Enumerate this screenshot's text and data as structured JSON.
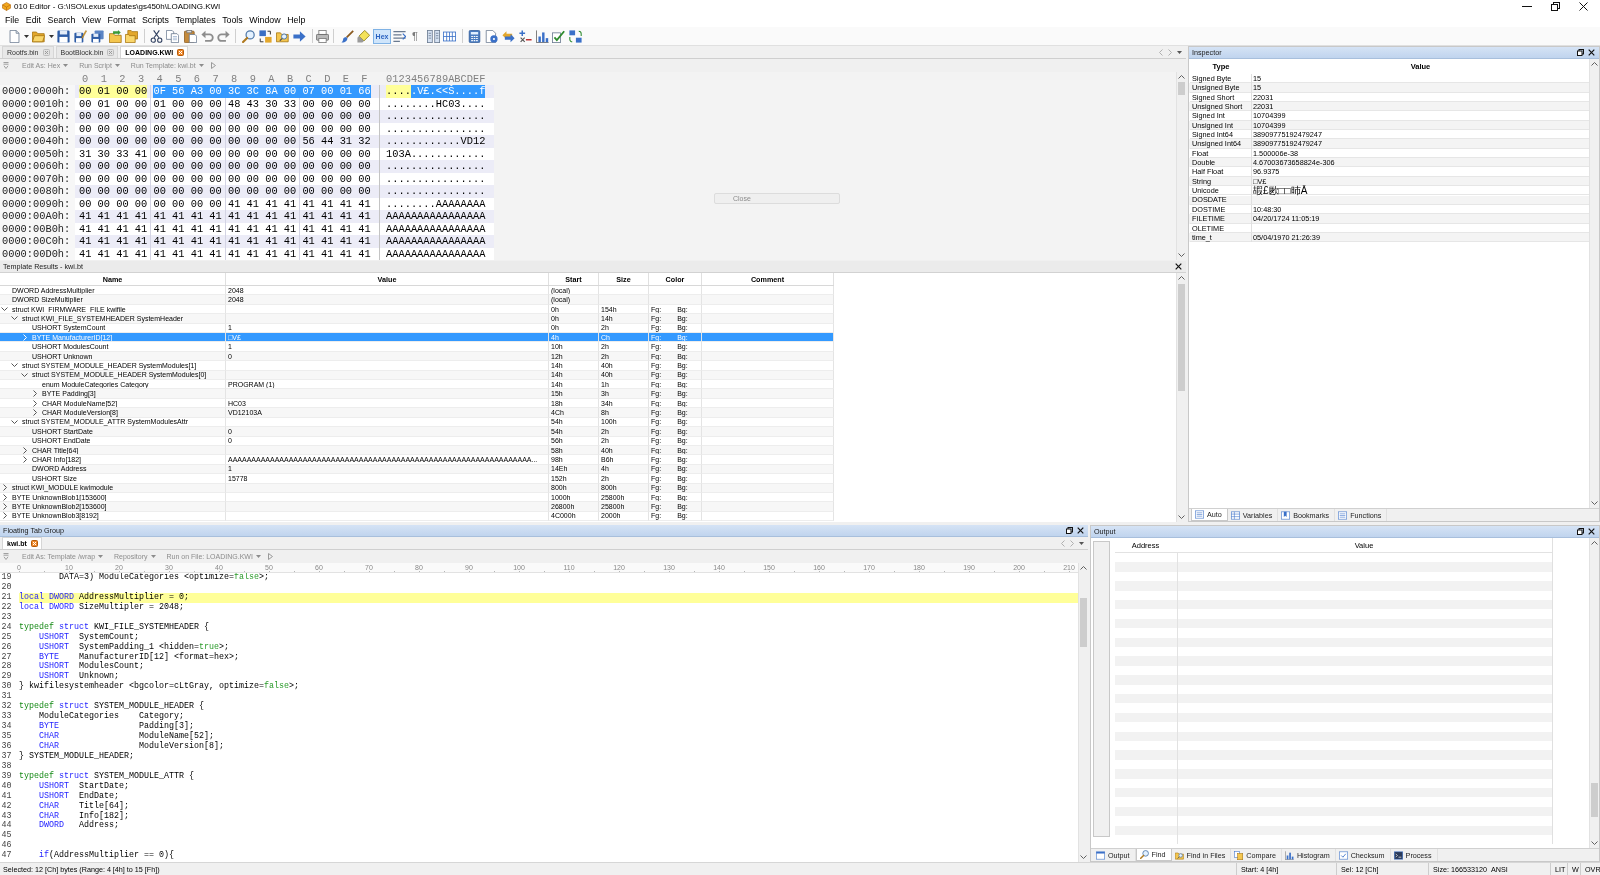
{
  "window": {
    "title": "010 Editor - G:\\ISO\\Lexus updates\\gs450h\\LOADING.KWI"
  },
  "menu": [
    "File",
    "Edit",
    "Search",
    "View",
    "Format",
    "Scripts",
    "Templates",
    "Tools",
    "Window",
    "Help"
  ],
  "toolbar": {
    "hex_button": {
      "label": "Hex",
      "on": true
    },
    "pilcrow": "¶"
  },
  "file_tabs": [
    {
      "label": "Rootfs.bin",
      "selected": false
    },
    {
      "label": "BootBlock.bin",
      "selected": false
    },
    {
      "label": "LOADING.KWI",
      "selected": true
    }
  ],
  "hex_view": {
    "toolbar": [
      "Edit As: Hex",
      "Run Script",
      "Run Template: kwi.bt"
    ],
    "columns": [
      "0",
      "1",
      "2",
      "3",
      "4",
      "5",
      "6",
      "7",
      "8",
      "9",
      "A",
      "B",
      "C",
      "D",
      "E",
      "F"
    ],
    "ascii_header": "0123456789ABCDEF",
    "rows": [
      {
        "address": "0000:0000h:",
        "spans": [
          {
            "marked": true,
            "selected": false,
            "bytes": [
              "00",
              "01",
              "00",
              "00"
            ],
            "ascii": "...."
          },
          {
            "marked": false,
            "selected": true,
            "bytes": [
              "0F",
              "56",
              "A3",
              "00",
              "3C",
              "3C",
              "8A",
              "00",
              "07",
              "00",
              "01",
              "66"
            ],
            "ascii": ".V£.<<Š....f"
          }
        ]
      },
      {
        "address": "0000:0010h:",
        "spans": [
          {
            "marked": false,
            "selected": false,
            "bytes": [
              "00",
              "01",
              "00",
              "00",
              "01",
              "00",
              "00",
              "00",
              "48",
              "43",
              "30",
              "33",
              "00",
              "00",
              "00",
              "00"
            ],
            "ascii": "........HC03...."
          }
        ]
      },
      {
        "address": "0000:0020h:",
        "spans": [
          {
            "marked": false,
            "selected": false,
            "bytes": [
              "00",
              "00",
              "00",
              "00",
              "00",
              "00",
              "00",
              "00",
              "00",
              "00",
              "00",
              "00",
              "00",
              "00",
              "00",
              "00"
            ],
            "ascii": "................"
          }
        ]
      },
      {
        "address": "0000:0030h:",
        "spans": [
          {
            "marked": false,
            "selected": false,
            "bytes": [
              "00",
              "00",
              "00",
              "00",
              "00",
              "00",
              "00",
              "00",
              "00",
              "00",
              "00",
              "00",
              "00",
              "00",
              "00",
              "00"
            ],
            "ascii": "................"
          }
        ]
      },
      {
        "address": "0000:0040h:",
        "spans": [
          {
            "marked": false,
            "selected": false,
            "bytes": [
              "00",
              "00",
              "00",
              "00",
              "00",
              "00",
              "00",
              "00",
              "00",
              "00",
              "00",
              "00",
              "56",
              "44",
              "31",
              "32"
            ],
            "ascii": "............VD12"
          }
        ]
      },
      {
        "address": "0000:0050h:",
        "spans": [
          {
            "marked": false,
            "selected": false,
            "bytes": [
              "31",
              "30",
              "33",
              "41",
              "00",
              "00",
              "00",
              "00",
              "00",
              "00",
              "00",
              "00",
              "00",
              "00",
              "00",
              "00"
            ],
            "ascii": "103A............"
          }
        ]
      },
      {
        "address": "0000:0060h:",
        "spans": [
          {
            "marked": false,
            "selected": false,
            "bytes": [
              "00",
              "00",
              "00",
              "00",
              "00",
              "00",
              "00",
              "00",
              "00",
              "00",
              "00",
              "00",
              "00",
              "00",
              "00",
              "00"
            ],
            "ascii": "................"
          }
        ]
      },
      {
        "address": "0000:0070h:",
        "spans": [
          {
            "marked": false,
            "selected": false,
            "bytes": [
              "00",
              "00",
              "00",
              "00",
              "00",
              "00",
              "00",
              "00",
              "00",
              "00",
              "00",
              "00",
              "00",
              "00",
              "00",
              "00"
            ],
            "ascii": "................"
          }
        ]
      },
      {
        "address": "0000:0080h:",
        "spans": [
          {
            "marked": false,
            "selected": false,
            "bytes": [
              "00",
              "00",
              "00",
              "00",
              "00",
              "00",
              "00",
              "00",
              "00",
              "00",
              "00",
              "00",
              "00",
              "00",
              "00",
              "00"
            ],
            "ascii": "................"
          }
        ]
      },
      {
        "address": "0000:0090h:",
        "spans": [
          {
            "marked": false,
            "selected": false,
            "bytes": [
              "00",
              "00",
              "00",
              "00",
              "00",
              "00",
              "00",
              "00",
              "41",
              "41",
              "41",
              "41",
              "41",
              "41",
              "41",
              "41"
            ],
            "ascii": "........AAAAAAAA"
          }
        ]
      },
      {
        "address": "0000:00A0h:",
        "spans": [
          {
            "marked": false,
            "selected": false,
            "bytes": [
              "41",
              "41",
              "41",
              "41",
              "41",
              "41",
              "41",
              "41",
              "41",
              "41",
              "41",
              "41",
              "41",
              "41",
              "41",
              "41"
            ],
            "ascii": "AAAAAAAAAAAAAAAA"
          }
        ]
      },
      {
        "address": "0000:00B0h:",
        "spans": [
          {
            "marked": false,
            "selected": false,
            "bytes": [
              "41",
              "41",
              "41",
              "41",
              "41",
              "41",
              "41",
              "41",
              "41",
              "41",
              "41",
              "41",
              "41",
              "41",
              "41",
              "41"
            ],
            "ascii": "AAAAAAAAAAAAAAAA"
          }
        ]
      },
      {
        "address": "0000:00C0h:",
        "spans": [
          {
            "marked": false,
            "selected": false,
            "bytes": [
              "41",
              "41",
              "41",
              "41",
              "41",
              "41",
              "41",
              "41",
              "41",
              "41",
              "41",
              "41",
              "41",
              "41",
              "41",
              "41"
            ],
            "ascii": "AAAAAAAAAAAAAAAA"
          }
        ]
      },
      {
        "address": "0000:00D0h:",
        "spans": [
          {
            "marked": false,
            "selected": false,
            "bytes": [
              "41",
              "41",
              "41",
              "41",
              "41",
              "41",
              "41",
              "41",
              "41",
              "41",
              "41",
              "41",
              "41",
              "41",
              "41",
              "41"
            ],
            "ascii": "AAAAAAAAAAAAAAAA"
          }
        ]
      }
    ],
    "overlay_button": "Close"
  },
  "template_results": {
    "title": "Template Results - kwi.bt",
    "columns": [
      "Name",
      "Value",
      "Start",
      "Size",
      "Color",
      "Comment"
    ],
    "rows": [
      {
        "name": "DWORD AddressMultiplier",
        "value": "2048",
        "start": "(local)",
        "selected": false
      },
      {
        "name": "DWORD SizeMultiplier",
        "value": "2048",
        "start": "(local)",
        "selected": false
      },
      {
        "name": "struct KWI_FIRMWARE_FILE kwifile",
        "start": "0h",
        "size": "154h",
        "fg": "Fg:",
        "bg": "Bg:",
        "expanded": true,
        "selected": false,
        "children": [
          {
            "name": "struct KWI_FILE_SYSTEMHEADER SystemHeader",
            "start": "0h",
            "size": "14h",
            "fg": "Fg:",
            "bg": "Bg:",
            "expanded": true,
            "selected": false,
            "children": [
              {
                "name": "USHORT SystemCount",
                "value": "1",
                "start": "0h",
                "size": "2h",
                "fg": "Fg:",
                "bg": "Bg:",
                "selected": false
              },
              {
                "name": "BYTE ManufacturerID[12]",
                "value": "□V£",
                "start": "4h",
                "size": "Ch",
                "fg": "Fg:",
                "bg": "Bg:",
                "expanded": false,
                "selected": true
              },
              {
                "name": "USHORT ModulesCount",
                "value": "1",
                "start": "10h",
                "size": "2h",
                "fg": "Fg:",
                "bg": "Bg:",
                "selected": false
              },
              {
                "name": "USHORT Unknown",
                "value": "0",
                "start": "12h",
                "size": "2h",
                "fg": "Fg:",
                "bg": "Bg:",
                "selected": false
              }
            ]
          },
          {
            "name": "struct SYSTEM_MODULE_HEADER SystemModules[1]",
            "start": "14h",
            "size": "40h",
            "fg": "Fg:",
            "bg": "Bg:",
            "expanded": true,
            "selected": false,
            "children": [
              {
                "name": "struct SYSTEM_MODULE_HEADER SystemModules[0]",
                "start": "14h",
                "size": "40h",
                "fg": "Fg:",
                "bg": "Bg:",
                "expanded": true,
                "selected": false,
                "children": [
                  {
                    "name": "enum ModuleCategories Category",
                    "value": "PROGRAM (1)",
                    "start": "14h",
                    "size": "1h",
                    "fg": "Fg:",
                    "bg": "Bg:",
                    "selected": false
                  },
                  {
                    "name": "BYTE Padding[3]",
                    "start": "15h",
                    "size": "3h",
                    "fg": "Fg:",
                    "bg": "Bg:",
                    "expanded": false,
                    "selected": false
                  },
                  {
                    "name": "CHAR ModuleName[52]",
                    "value": "HC03",
                    "start": "18h",
                    "size": "34h",
                    "fg": "Fg:",
                    "bg": "Bg:",
                    "expanded": false,
                    "selected": false
                  },
                  {
                    "name": "CHAR ModuleVersion[8]",
                    "value": "VD12103A",
                    "start": "4Ch",
                    "size": "8h",
                    "fg": "Fg:",
                    "bg": "Bg:",
                    "expanded": false,
                    "selected": false
                  }
                ]
              }
            ]
          },
          {
            "name": "struct SYSTEM_MODULE_ATTR SystemModulesAttr",
            "start": "54h",
            "size": "100h",
            "fg": "Fg:",
            "bg": "Bg:",
            "expanded": true,
            "selected": false,
            "children": [
              {
                "name": "USHORT StartDate",
                "value": "0",
                "start": "54h",
                "size": "2h",
                "fg": "Fg:",
                "bg": "Bg:",
                "selected": false
              },
              {
                "name": "USHORT EndDate",
                "value": "0",
                "start": "56h",
                "size": "2h",
                "fg": "Fg:",
                "bg": "Bg:",
                "selected": false
              },
              {
                "name": "CHAR Title[64]",
                "start": "58h",
                "size": "40h",
                "fg": "Fg:",
                "bg": "Bg:",
                "expanded": false,
                "selected": false
              },
              {
                "name": "CHAR Info[182]",
                "value": "AAAAAAAAAAAAAAAAAAAAAAAAAAAAAAAAAAAAAAAAAAAAAAAAAAAAAAAAAAAAAAAAA...",
                "start": "98h",
                "size": "B6h",
                "fg": "Fg:",
                "bg": "Bg:",
                "expanded": false,
                "selected": false
              },
              {
                "name": "DWORD Address",
                "value": "1",
                "start": "14Eh",
                "size": "4h",
                "fg": "Fg:",
                "bg": "Bg:",
                "selected": false
              },
              {
                "name": "USHORT Size",
                "value": "15778",
                "start": "152h",
                "size": "2h",
                "fg": "Fg:",
                "bg": "Bg:",
                "selected": false
              }
            ]
          }
        ]
      },
      {
        "name": "struct KWI_MODULE kwimodule",
        "start": "800h",
        "size": "800h",
        "fg": "Fg:",
        "bg": "Bg:",
        "expanded": false,
        "selected": false
      },
      {
        "name": "BYTE UnknownBlob1[153600]",
        "start": "1000h",
        "size": "25800h",
        "fg": "Fg:",
        "bg": "Bg:",
        "expanded": false,
        "selected": false
      },
      {
        "name": "BYTE UnknownBlob2[153600]",
        "start": "26800h",
        "size": "25800h",
        "fg": "Fg:",
        "bg": "Bg:",
        "expanded": false,
        "selected": false
      },
      {
        "name": "BYTE UnknownBlob3[8192]",
        "start": "4C000h",
        "size": "2000h",
        "fg": "Fg:",
        "bg": "Bg:",
        "expanded": false,
        "selected": false
      }
    ]
  },
  "inspector": {
    "title": "Inspector",
    "columns": [
      "Type",
      "Value"
    ],
    "rows": [
      {
        "type": "Signed Byte",
        "value": "15"
      },
      {
        "type": "Unsigned Byte",
        "value": "15"
      },
      {
        "type": "Signed Short",
        "value": "22031"
      },
      {
        "type": "Unsigned Short",
        "value": "22031"
      },
      {
        "type": "Signed Int",
        "value": "10704399"
      },
      {
        "type": "Unsigned Int",
        "value": "10704399"
      },
      {
        "type": "Signed Int64",
        "value": "38909775192479247"
      },
      {
        "type": "Unsigned Int64",
        "value": "38909775192479247"
      },
      {
        "type": "Float",
        "value": "1.500006e-38"
      },
      {
        "type": "Double",
        "value": "4.67003673658824e-306"
      },
      {
        "type": "Half Float",
        "value": "96.9375"
      },
      {
        "type": "String",
        "value": "□V£"
      },
      {
        "type": "Unicode",
        "value": "嘏£㰼□□昁Ā"
      },
      {
        "type": "DOSDATE"
      },
      {
        "type": "DOSTIME",
        "value": "10:48:30"
      },
      {
        "type": "FILETIME",
        "value": "04/20/1724 11:05:19"
      },
      {
        "type": "OLETIME"
      },
      {
        "type": "time_t",
        "value": "05/04/1970 21:26:39"
      }
    ],
    "tabs": [
      {
        "label": "Auto",
        "selected": true
      },
      {
        "label": "Variables",
        "selected": false
      },
      {
        "label": "Bookmarks",
        "selected": false
      },
      {
        "label": "Functions",
        "selected": false
      }
    ]
  },
  "editor": {
    "title": "Floating Tab Group",
    "tabs": [
      {
        "label": "kwi.bt",
        "selected": true
      }
    ],
    "toolbar": [
      "Edit As: Template /wrap",
      "Repository",
      "Run on File: LOADING.KWI"
    ],
    "ruler": [
      "0",
      "10",
      "20",
      "30",
      "40",
      "50",
      "60",
      "70",
      "80",
      "90",
      "100",
      "110",
      "120",
      "130",
      "140",
      "150",
      "160",
      "170",
      "180",
      "190",
      "200",
      "210"
    ],
    "lines": [
      {
        "number": "19",
        "highlighted": false,
        "tokens": [
          {
            "kind": "plain",
            "text": "        DATA=3) ModuleCategories <optimize="
          },
          {
            "kind": "literal",
            "text": "false"
          },
          {
            "kind": "plain",
            "text": ">;"
          }
        ]
      },
      {
        "number": "20",
        "highlighted": false
      },
      {
        "number": "21",
        "highlighted": true,
        "tokens": [
          {
            "kind": "keyword",
            "text": "local"
          },
          {
            "kind": "type",
            "text": " DWORD"
          },
          {
            "kind": "plain",
            "text": " AddressMultiplier = 0;"
          }
        ]
      },
      {
        "number": "22",
        "highlighted": false,
        "tokens": [
          {
            "kind": "keyword",
            "text": "local"
          },
          {
            "kind": "type",
            "text": " DWORD"
          },
          {
            "kind": "plain",
            "text": " SizeMultipler = 2048;"
          }
        ]
      },
      {
        "number": "23",
        "highlighted": false
      },
      {
        "number": "24",
        "highlighted": false,
        "tokens": [
          {
            "kind": "storage",
            "text": "typedef"
          },
          {
            "kind": "keyword",
            "text": " struct"
          },
          {
            "kind": "plain",
            "text": " KWI_FILE_SYSTEMHEADER {"
          }
        ]
      },
      {
        "number": "25",
        "highlighted": false,
        "tokens": [
          {
            "kind": "type",
            "text": "    USHORT"
          },
          {
            "kind": "plain",
            "text": "  SystemCount;"
          }
        ]
      },
      {
        "number": "26",
        "highlighted": false,
        "tokens": [
          {
            "kind": "type",
            "text": "    USHORT"
          },
          {
            "kind": "plain",
            "text": "  SystemPadding_1 <hidden="
          },
          {
            "kind": "literal",
            "text": "true"
          },
          {
            "kind": "plain",
            "text": ">;"
          }
        ]
      },
      {
        "number": "27",
        "highlighted": false,
        "tokens": [
          {
            "kind": "type",
            "text": "    BYTE"
          },
          {
            "kind": "plain",
            "text": "    ManufacturerID[12] <format=hex>;"
          }
        ]
      },
      {
        "number": "28",
        "highlighted": false,
        "tokens": [
          {
            "kind": "type",
            "text": "    USHORT"
          },
          {
            "kind": "plain",
            "text": "  ModulesCount;"
          }
        ]
      },
      {
        "number": "29",
        "highlighted": false,
        "tokens": [
          {
            "kind": "type",
            "text": "    USHORT"
          },
          {
            "kind": "plain",
            "text": "  Unknown;"
          }
        ]
      },
      {
        "number": "30",
        "highlighted": false,
        "tokens": [
          {
            "kind": "plain",
            "text": "} kwifilesystemheader <bgcolor=cLtGray, optimize="
          },
          {
            "kind": "literal",
            "text": "false"
          },
          {
            "kind": "plain",
            "text": ">;"
          }
        ]
      },
      {
        "number": "31",
        "highlighted": false
      },
      {
        "number": "32",
        "highlighted": false,
        "tokens": [
          {
            "kind": "storage",
            "text": "typedef"
          },
          {
            "kind": "keyword",
            "text": " struct"
          },
          {
            "kind": "plain",
            "text": " SYSTEM_MODULE_HEADER {"
          }
        ]
      },
      {
        "number": "33",
        "highlighted": false,
        "tokens": [
          {
            "kind": "plain",
            "text": "    ModuleCategories    Category;"
          }
        ]
      },
      {
        "number": "34",
        "highlighted": false,
        "tokens": [
          {
            "kind": "type",
            "text": "    BYTE"
          },
          {
            "kind": "plain",
            "text": "                Padding[3];"
          }
        ]
      },
      {
        "number": "35",
        "highlighted": false,
        "tokens": [
          {
            "kind": "type",
            "text": "    CHAR"
          },
          {
            "kind": "plain",
            "text": "                ModuleName[52];"
          }
        ]
      },
      {
        "number": "36",
        "highlighted": false,
        "tokens": [
          {
            "kind": "type",
            "text": "    CHAR"
          },
          {
            "kind": "plain",
            "text": "                ModuleVersion[8];"
          }
        ]
      },
      {
        "number": "37",
        "highlighted": false,
        "tokens": [
          {
            "kind": "plain",
            "text": "} SYSTEM_MODULE_HEADER;"
          }
        ]
      },
      {
        "number": "38",
        "highlighted": false
      },
      {
        "number": "39",
        "highlighted": false,
        "tokens": [
          {
            "kind": "storage",
            "text": "typedef"
          },
          {
            "kind": "keyword",
            "text": " struct"
          },
          {
            "kind": "plain",
            "text": " SYSTEM_MODULE_ATTR {"
          }
        ]
      },
      {
        "number": "40",
        "highlighted": false,
        "tokens": [
          {
            "kind": "type",
            "text": "    USHORT"
          },
          {
            "kind": "plain",
            "text": "  StartDate;"
          }
        ]
      },
      {
        "number": "41",
        "highlighted": false,
        "tokens": [
          {
            "kind": "type",
            "text": "    USHORT"
          },
          {
            "kind": "plain",
            "text": "  EndDate;"
          }
        ]
      },
      {
        "number": "42",
        "highlighted": false,
        "tokens": [
          {
            "kind": "type",
            "text": "    CHAR"
          },
          {
            "kind": "plain",
            "text": "    Title[64];"
          }
        ]
      },
      {
        "number": "43",
        "highlighted": false,
        "tokens": [
          {
            "kind": "type",
            "text": "    CHAR"
          },
          {
            "kind": "plain",
            "text": "    Info[182];"
          }
        ]
      },
      {
        "number": "44",
        "highlighted": false,
        "tokens": [
          {
            "kind": "type",
            "text": "    DWORD"
          },
          {
            "kind": "plain",
            "text": "   Address;"
          }
        ]
      },
      {
        "number": "45",
        "highlighted": false
      },
      {
        "number": "46",
        "highlighted": false
      },
      {
        "number": "47",
        "highlighted": false,
        "tokens": [
          {
            "kind": "keyword",
            "text": "    if"
          },
          {
            "kind": "plain",
            "text": "(AddressMultiplier == 0){"
          }
        ]
      }
    ]
  },
  "output": {
    "title": "Output",
    "columns": [
      "Address",
      "Value"
    ],
    "tabs": [
      {
        "label": "Output",
        "selected": false
      },
      {
        "label": "Find",
        "selected": true
      },
      {
        "label": "Find in Files",
        "selected": false
      },
      {
        "label": "Compare",
        "selected": false
      },
      {
        "label": "Histogram",
        "selected": false
      },
      {
        "label": "Checksum",
        "selected": false
      },
      {
        "label": "Process",
        "selected": false
      }
    ]
  },
  "status_bar": {
    "selection": "Selected: 12 [Ch] bytes (Range: 4 [4h] to 15 [Fh])",
    "start": "Start: 4 [4h]",
    "sel": "Sel: 12 [Ch]",
    "size": "Size: 166533120",
    "encoding": "ANSI",
    "endian": "LIT",
    "width": "W",
    "mode": "OVR"
  }
}
